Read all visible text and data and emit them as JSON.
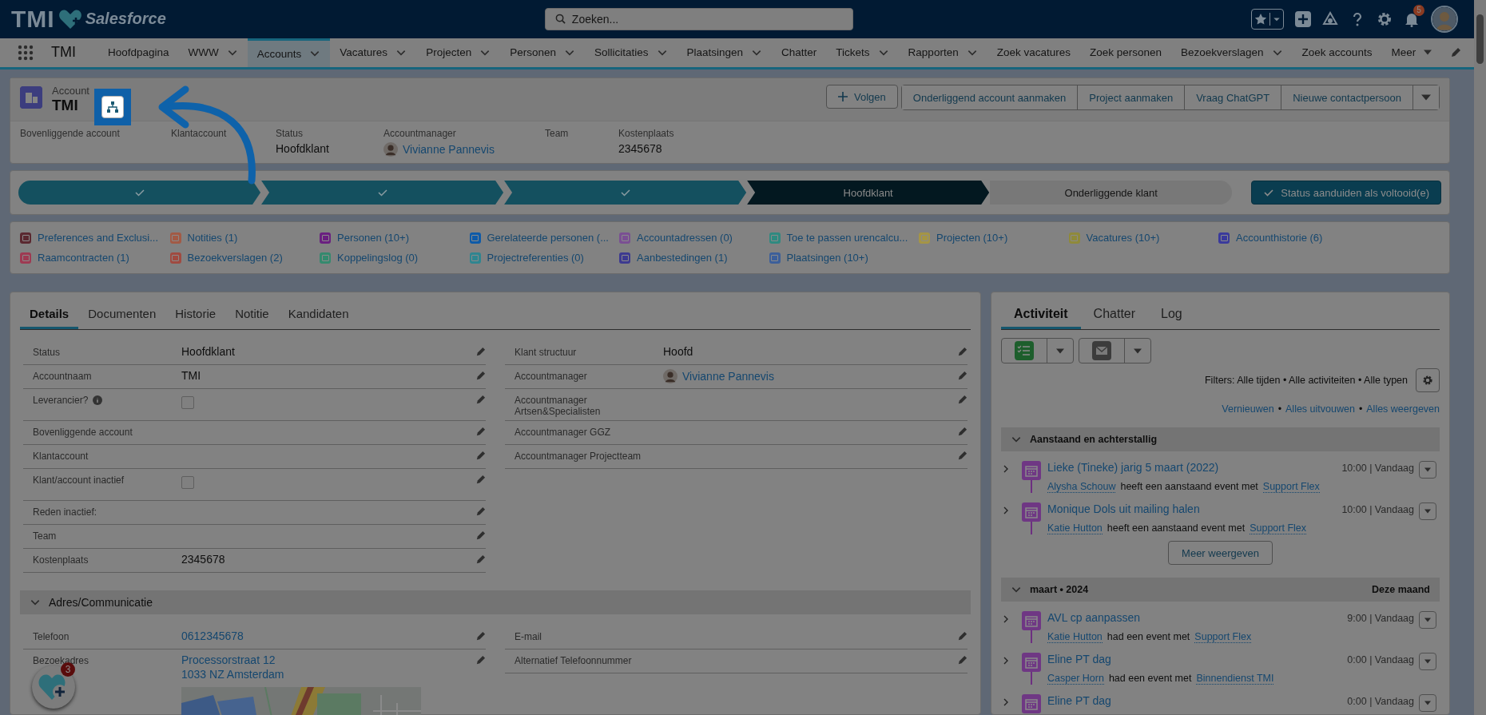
{
  "app": {
    "logo": "TMI",
    "logo_suffix": "Salesforce",
    "search_placeholder": "Zoeken...",
    "notification_count": "5"
  },
  "nav": {
    "app_name": "TMI",
    "items": [
      {
        "label": "Hoofdpagina",
        "kind": "plain",
        "selected": false
      },
      {
        "label": "WWW",
        "kind": "dropdown",
        "selected": false
      },
      {
        "label": "Accounts",
        "kind": "dropdown",
        "selected": true
      },
      {
        "label": "Vacatures",
        "kind": "dropdown",
        "selected": false
      },
      {
        "label": "Projecten",
        "kind": "dropdown",
        "selected": false
      },
      {
        "label": "Personen",
        "kind": "dropdown",
        "selected": false
      },
      {
        "label": "Sollicitaties",
        "kind": "dropdown",
        "selected": false
      },
      {
        "label": "Plaatsingen",
        "kind": "dropdown",
        "selected": false
      },
      {
        "label": "Chatter",
        "kind": "plain",
        "selected": false
      },
      {
        "label": "Tickets",
        "kind": "dropdown",
        "selected": false
      },
      {
        "label": "Rapporten",
        "kind": "dropdown",
        "selected": false
      },
      {
        "label": "Zoek vacatures",
        "kind": "plain",
        "selected": false
      },
      {
        "label": "Zoek personen",
        "kind": "plain",
        "selected": false
      },
      {
        "label": "Bezoekverslagen",
        "kind": "dropdown",
        "selected": false
      },
      {
        "label": "Zoek accounts",
        "kind": "plain",
        "selected": false
      },
      {
        "label": "Meer",
        "kind": "more",
        "selected": false
      }
    ]
  },
  "record": {
    "object_label": "Account",
    "name": "TMI",
    "follow_button": "Volgen",
    "actions": [
      "Onderliggend account aanmaken",
      "Project aanmaken",
      "Vraag ChatGPT",
      "Nieuwe contactpersoon"
    ],
    "highlights": [
      {
        "label": "Bovenliggende account"
      },
      {
        "label": "Klantaccount"
      },
      {
        "label": "Status",
        "value": "Hoofdklant",
        "kind": "text"
      },
      {
        "label": "Accountmanager",
        "value": "Vivianne Pannevis",
        "kind": "user"
      },
      {
        "label": "Team"
      },
      {
        "label": "Kostenplaats",
        "value": "2345678",
        "kind": "text"
      }
    ]
  },
  "path": {
    "steps": [
      {
        "completed": true,
        "selected": false
      },
      {
        "completed": true,
        "selected": false
      },
      {
        "completed": true,
        "selected": false
      },
      {
        "label": "Hoofdklant",
        "completed": false,
        "selected": true
      },
      {
        "label": "Onderliggende klant",
        "completed": false,
        "selected": false
      }
    ],
    "action": "Status aanduiden als voltooid(e)"
  },
  "related_lists": [
    {
      "label": "Preferences and Exclusi...",
      "color": "#5a2830"
    },
    {
      "label": "Notities (1)",
      "color": "#a25a45"
    },
    {
      "label": "Personen (10+)",
      "color": "#6a1f80"
    },
    {
      "label": "Gerelateerde personen (...",
      "color": "#0d5aa8"
    },
    {
      "label": "Accountadressen (0)",
      "color": "#7a4f93"
    },
    {
      "label": "Toe te passen urencalcu...",
      "color": "#2f8a80"
    },
    {
      "label": "Projecten (10+)",
      "color": "#a59545"
    },
    {
      "label": "Vacatures (10+)",
      "color": "#8f8a3a"
    },
    {
      "label": "Accounthistorie (6)",
      "color": "#3a3a9c"
    },
    {
      "label": "Raamcontracten (1)",
      "color": "#9e3a52"
    },
    {
      "label": "Bezoekverslagen (2)",
      "color": "#a04a40"
    },
    {
      "label": "Koppelingslog (0)",
      "color": "#348a6e"
    },
    {
      "label": "Projectreferenties (0)",
      "color": "#2f8590"
    },
    {
      "label": "Aanbestedingen (1)",
      "color": "#3d3a90"
    },
    {
      "label": "Plaatsingen (10+)",
      "color": "#3c5f9a"
    }
  ],
  "details": {
    "tabs": [
      {
        "label": "Details",
        "selected": true
      },
      {
        "label": "Documenten",
        "selected": false
      },
      {
        "label": "Historie",
        "selected": false
      },
      {
        "label": "Notitie",
        "selected": false
      },
      {
        "label": "Kandidaten",
        "selected": false
      }
    ],
    "fields_left": [
      {
        "label": "Status",
        "value": "Hoofdklant",
        "kind": "text"
      },
      {
        "label": "Accountnaam",
        "value": "TMI",
        "kind": "text"
      },
      {
        "label": "Leverancier?",
        "kind": "checkbox",
        "checked": false,
        "info": true
      },
      {
        "label": "Bovenliggende account"
      },
      {
        "label": "Klantaccount"
      },
      {
        "label": "Klant/account inactief",
        "kind": "checkbox",
        "checked": false
      },
      {
        "label": "Reden inactief:"
      },
      {
        "label": "Team"
      },
      {
        "label": "Kostenplaats",
        "value": "2345678",
        "kind": "text"
      }
    ],
    "fields_right": [
      {
        "label": "Klant structuur",
        "value": "Hoofd",
        "kind": "text"
      },
      {
        "label": "Accountmanager",
        "value": "Vivianne Pannevis",
        "kind": "user"
      },
      {
        "label": "Accountmanager Artsen&Specialisten"
      },
      {
        "label": "Accountmanager GGZ"
      },
      {
        "label": "Accountmanager Projectteam"
      }
    ],
    "section": {
      "title": "Adres/Communicatie",
      "expanded": true,
      "fields_left": [
        {
          "label": "Telefoon",
          "value": "0612345678",
          "kind": "link"
        },
        {
          "label": "Bezoekadres",
          "lines": [
            "Processorstraat 12",
            "1033 NZ Amsterdam"
          ],
          "kind": "address"
        }
      ],
      "fields_right": [
        {
          "label": "E-mail"
        },
        {
          "label": "Alternatief Telefoonnummer"
        }
      ]
    }
  },
  "activity": {
    "tabs": [
      {
        "label": "Activiteit",
        "selected": true
      },
      {
        "label": "Chatter",
        "selected": false
      },
      {
        "label": "Log",
        "selected": false
      }
    ],
    "filters": "Filters: Alle tijden • Alle activiteiten • Alle typen",
    "links": [
      "Vernieuwen",
      "Alles uitvouwen",
      "Alles weergeven"
    ],
    "link_separator": "•",
    "groups": [
      {
        "title": "Aanstaand en achterstallig",
        "expanded": true,
        "more_button": "Meer weergeven",
        "items": [
          {
            "title": "Lieke (Tineke) jarig 5 maart (2022)",
            "time": "10:00 | Vandaag",
            "actor": "Alysha Schouw",
            "verb": "heeft een aanstaand event met",
            "target": "Support Flex"
          },
          {
            "title": "Monique Dols uit mailing halen",
            "time": "10:00 | Vandaag",
            "actor": "Katie Hutton",
            "verb": "heeft een aanstaand event met",
            "target": "Support Flex"
          }
        ]
      },
      {
        "title": "maart • 2024",
        "badge": "Deze maand",
        "expanded": true,
        "items": [
          {
            "title": "AVL cp aanpassen",
            "time": "9:00 | Vandaag",
            "actor": "Katie Hutton",
            "verb": "had een event met",
            "target": "Support Flex"
          },
          {
            "title": "Eline PT dag",
            "time": "0:00 | Vandaag",
            "actor": "Casper Horn",
            "verb": "had een event met",
            "target": "Binnendienst TMI"
          },
          {
            "title": "Eline PT dag",
            "time": "0:00 | Vandaag"
          }
        ]
      }
    ]
  },
  "utility": {
    "badge": "3"
  }
}
